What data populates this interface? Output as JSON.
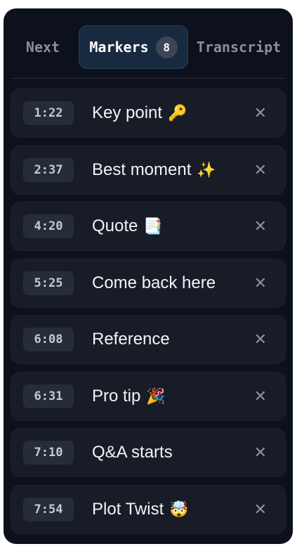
{
  "tabs": {
    "next": "Next",
    "markers": "Markers",
    "markers_count": "8",
    "transcript": "Transcript"
  },
  "markers": [
    {
      "time": "1:22",
      "label": "Key point",
      "emoji": "🔑"
    },
    {
      "time": "2:37",
      "label": "Best moment",
      "emoji": "✨"
    },
    {
      "time": "4:20",
      "label": "Quote",
      "emoji": "📑"
    },
    {
      "time": "5:25",
      "label": "Come back here",
      "emoji": ""
    },
    {
      "time": "6:08",
      "label": "Reference",
      "emoji": ""
    },
    {
      "time": "6:31",
      "label": "Pro tip",
      "emoji": "🎉"
    },
    {
      "time": "7:10",
      "label": "Q&A starts",
      "emoji": ""
    },
    {
      "time": "7:54",
      "label": "Plot Twist",
      "emoji": "🤯"
    }
  ],
  "close_glyph": "✕"
}
